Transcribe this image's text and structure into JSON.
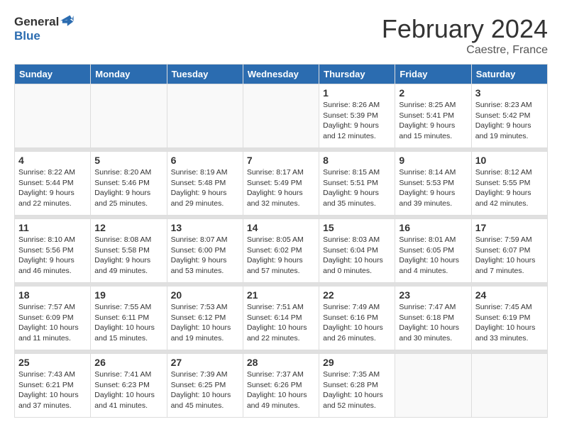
{
  "header": {
    "logo_general": "General",
    "logo_blue": "Blue",
    "month_title": "February 2024",
    "location": "Caestre, France"
  },
  "days_of_week": [
    "Sunday",
    "Monday",
    "Tuesday",
    "Wednesday",
    "Thursday",
    "Friday",
    "Saturday"
  ],
  "weeks": [
    [
      {
        "day": "",
        "info": ""
      },
      {
        "day": "",
        "info": ""
      },
      {
        "day": "",
        "info": ""
      },
      {
        "day": "",
        "info": ""
      },
      {
        "day": "1",
        "info": "Sunrise: 8:26 AM\nSunset: 5:39 PM\nDaylight: 9 hours\nand 12 minutes."
      },
      {
        "day": "2",
        "info": "Sunrise: 8:25 AM\nSunset: 5:41 PM\nDaylight: 9 hours\nand 15 minutes."
      },
      {
        "day": "3",
        "info": "Sunrise: 8:23 AM\nSunset: 5:42 PM\nDaylight: 9 hours\nand 19 minutes."
      }
    ],
    [
      {
        "day": "4",
        "info": "Sunrise: 8:22 AM\nSunset: 5:44 PM\nDaylight: 9 hours\nand 22 minutes."
      },
      {
        "day": "5",
        "info": "Sunrise: 8:20 AM\nSunset: 5:46 PM\nDaylight: 9 hours\nand 25 minutes."
      },
      {
        "day": "6",
        "info": "Sunrise: 8:19 AM\nSunset: 5:48 PM\nDaylight: 9 hours\nand 29 minutes."
      },
      {
        "day": "7",
        "info": "Sunrise: 8:17 AM\nSunset: 5:49 PM\nDaylight: 9 hours\nand 32 minutes."
      },
      {
        "day": "8",
        "info": "Sunrise: 8:15 AM\nSunset: 5:51 PM\nDaylight: 9 hours\nand 35 minutes."
      },
      {
        "day": "9",
        "info": "Sunrise: 8:14 AM\nSunset: 5:53 PM\nDaylight: 9 hours\nand 39 minutes."
      },
      {
        "day": "10",
        "info": "Sunrise: 8:12 AM\nSunset: 5:55 PM\nDaylight: 9 hours\nand 42 minutes."
      }
    ],
    [
      {
        "day": "11",
        "info": "Sunrise: 8:10 AM\nSunset: 5:56 PM\nDaylight: 9 hours\nand 46 minutes."
      },
      {
        "day": "12",
        "info": "Sunrise: 8:08 AM\nSunset: 5:58 PM\nDaylight: 9 hours\nand 49 minutes."
      },
      {
        "day": "13",
        "info": "Sunrise: 8:07 AM\nSunset: 6:00 PM\nDaylight: 9 hours\nand 53 minutes."
      },
      {
        "day": "14",
        "info": "Sunrise: 8:05 AM\nSunset: 6:02 PM\nDaylight: 9 hours\nand 57 minutes."
      },
      {
        "day": "15",
        "info": "Sunrise: 8:03 AM\nSunset: 6:04 PM\nDaylight: 10 hours\nand 0 minutes."
      },
      {
        "day": "16",
        "info": "Sunrise: 8:01 AM\nSunset: 6:05 PM\nDaylight: 10 hours\nand 4 minutes."
      },
      {
        "day": "17",
        "info": "Sunrise: 7:59 AM\nSunset: 6:07 PM\nDaylight: 10 hours\nand 7 minutes."
      }
    ],
    [
      {
        "day": "18",
        "info": "Sunrise: 7:57 AM\nSunset: 6:09 PM\nDaylight: 10 hours\nand 11 minutes."
      },
      {
        "day": "19",
        "info": "Sunrise: 7:55 AM\nSunset: 6:11 PM\nDaylight: 10 hours\nand 15 minutes."
      },
      {
        "day": "20",
        "info": "Sunrise: 7:53 AM\nSunset: 6:12 PM\nDaylight: 10 hours\nand 19 minutes."
      },
      {
        "day": "21",
        "info": "Sunrise: 7:51 AM\nSunset: 6:14 PM\nDaylight: 10 hours\nand 22 minutes."
      },
      {
        "day": "22",
        "info": "Sunrise: 7:49 AM\nSunset: 6:16 PM\nDaylight: 10 hours\nand 26 minutes."
      },
      {
        "day": "23",
        "info": "Sunrise: 7:47 AM\nSunset: 6:18 PM\nDaylight: 10 hours\nand 30 minutes."
      },
      {
        "day": "24",
        "info": "Sunrise: 7:45 AM\nSunset: 6:19 PM\nDaylight: 10 hours\nand 33 minutes."
      }
    ],
    [
      {
        "day": "25",
        "info": "Sunrise: 7:43 AM\nSunset: 6:21 PM\nDaylight: 10 hours\nand 37 minutes."
      },
      {
        "day": "26",
        "info": "Sunrise: 7:41 AM\nSunset: 6:23 PM\nDaylight: 10 hours\nand 41 minutes."
      },
      {
        "day": "27",
        "info": "Sunrise: 7:39 AM\nSunset: 6:25 PM\nDaylight: 10 hours\nand 45 minutes."
      },
      {
        "day": "28",
        "info": "Sunrise: 7:37 AM\nSunset: 6:26 PM\nDaylight: 10 hours\nand 49 minutes."
      },
      {
        "day": "29",
        "info": "Sunrise: 7:35 AM\nSunset: 6:28 PM\nDaylight: 10 hours\nand 52 minutes."
      },
      {
        "day": "",
        "info": ""
      },
      {
        "day": "",
        "info": ""
      }
    ]
  ]
}
